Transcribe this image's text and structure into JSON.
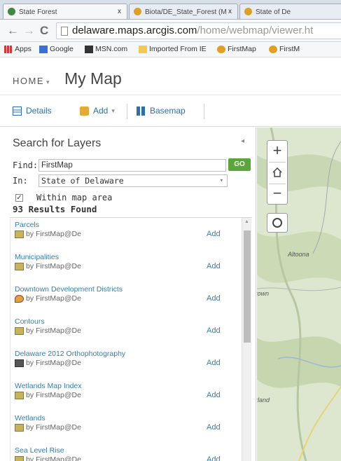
{
  "browser": {
    "tabs": [
      {
        "title": "State Forest",
        "favicon_color": "#3f8a3f"
      },
      {
        "title": "Biota/DE_State_Forest (M",
        "favicon_color": "#e0a020"
      },
      {
        "title": "State of De",
        "favicon_color": "#e0a020"
      }
    ],
    "tab_close": "x",
    "url_host": "delaware.maps.arcgis.com",
    "url_path": "/home/webmap/viewer.ht",
    "bookmarks": [
      "Apps",
      "Google",
      "MSN.com",
      "Imported From IE",
      "FirstMap",
      "FirstM"
    ]
  },
  "app": {
    "home_label": "HOME",
    "home_caret": "▾",
    "map_title": "My Map",
    "toolbar": {
      "details_label": "Details",
      "add_label": "Add",
      "add_caret": "▾",
      "basemap_label": "Basemap"
    }
  },
  "search": {
    "title": "Search for Layers",
    "collapse_glyph": "◂",
    "find_label": "Find:",
    "find_value": "FirstMap",
    "go_label": "GO",
    "in_label": "In:",
    "in_value": "State of Delaware",
    "within_checked": true,
    "within_label": "Within map area",
    "results_count": "93 Results Found",
    "results": [
      {
        "title": "Parcels",
        "owner": "by FirstMap@De",
        "add": "Add",
        "icon": "layer"
      },
      {
        "title": "Municipalities",
        "owner": "by FirstMap@De",
        "add": "Add",
        "icon": "layer"
      },
      {
        "title": "Downtown Development Districts",
        "owner": "by FirstMap@De",
        "add": "Add",
        "icon": "pin"
      },
      {
        "title": "Contours",
        "owner": "by FirstMap@De",
        "add": "Add",
        "icon": "layer"
      },
      {
        "title": "Delaware 2012 Orthophotography",
        "owner": "by FirstMap@De",
        "add": "Add",
        "icon": "imagery"
      },
      {
        "title": "Wetlands Map Index",
        "owner": "by FirstMap@De",
        "add": "Add",
        "icon": "layer"
      },
      {
        "title": "Wetlands",
        "owner": "by FirstMap@De",
        "add": "Add",
        "icon": "layer"
      },
      {
        "title": "Sea Level Rise",
        "owner": "by FirstMap@De",
        "add": "Add",
        "icon": "layer"
      }
    ]
  },
  "map": {
    "zoom_in": "+",
    "zoom_out": "−",
    "labels": [
      "Altoona",
      "town",
      "rland"
    ]
  }
}
